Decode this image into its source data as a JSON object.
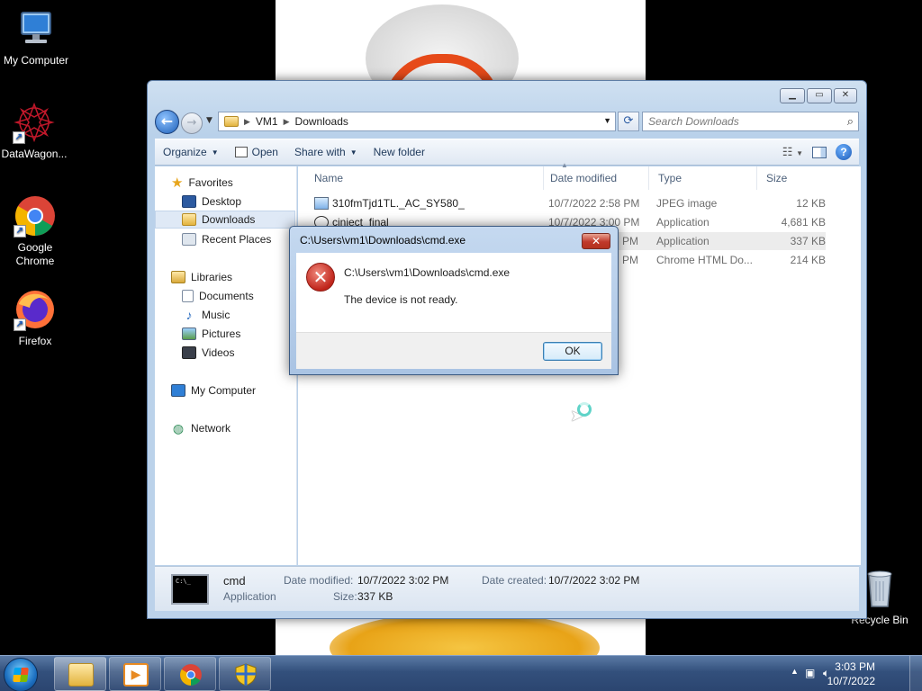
{
  "desktop": {
    "icons": [
      {
        "label": "My Computer",
        "icon": "computer-icon"
      },
      {
        "label": "DataWagon...",
        "icon": "datawagon-icon"
      },
      {
        "label": "Google Chrome",
        "icon": "chrome-icon"
      },
      {
        "label": "Firefox",
        "icon": "firefox-icon"
      },
      {
        "label": "Recycle Bin",
        "icon": "recycle-bin-icon"
      }
    ]
  },
  "explorer": {
    "breadcrumb": [
      "VM1",
      "Downloads"
    ],
    "search_placeholder": "Search Downloads",
    "toolbar": {
      "organize": "Organize",
      "open": "Open",
      "share_with": "Share with",
      "new_folder": "New folder"
    },
    "nav": {
      "favorites": "Favorites",
      "desktop": "Desktop",
      "downloads": "Downloads",
      "recent_places": "Recent Places",
      "libraries": "Libraries",
      "documents": "Documents",
      "music": "Music",
      "pictures": "Pictures",
      "videos": "Videos",
      "my_computer": "My Computer",
      "network": "Network"
    },
    "columns": {
      "name": "Name",
      "date_modified": "Date modified",
      "type": "Type",
      "size": "Size"
    },
    "files": [
      {
        "name": "310fmTjd1TL._AC_SY580_",
        "date": "10/7/2022 2:58 PM",
        "type": "JPEG image",
        "size": "12 KB"
      },
      {
        "name": "ciniect_final",
        "date": "10/7/2022 3:00 PM",
        "type": "Application",
        "size": "4,681 KB"
      },
      {
        "name": "cmd",
        "date": "PM",
        "type": "Application",
        "size": "337 KB"
      },
      {
        "name": "",
        "date": "PM",
        "type": "Chrome HTML Do...",
        "size": "214 KB"
      }
    ],
    "details": {
      "name": "cmd",
      "kind": "Application",
      "date_modified_label": "Date modified:",
      "date_modified": "10/7/2022 3:02 PM",
      "date_created_label": "Date created:",
      "date_created": "10/7/2022 3:02 PM",
      "size_label": "Size:",
      "size": "337 KB"
    }
  },
  "dialog": {
    "title": "C:\\Users\\vm1\\Downloads\\cmd.exe",
    "path": "C:\\Users\\vm1\\Downloads\\cmd.exe",
    "message": "The device is not ready.",
    "ok": "OK",
    "close_glyph": "✕"
  },
  "taskbar": {
    "time": "3:03 PM",
    "date": "10/7/2022"
  }
}
